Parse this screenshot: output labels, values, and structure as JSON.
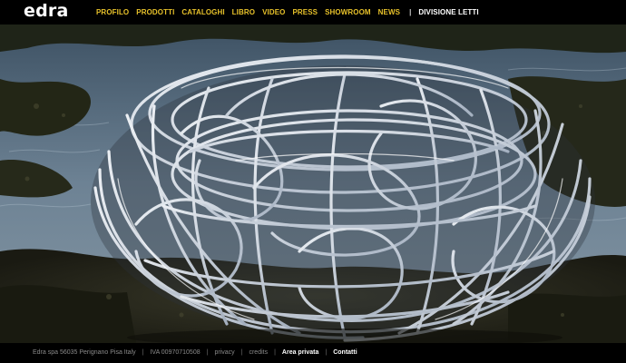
{
  "brand": {
    "logo": "edra"
  },
  "nav": {
    "items": [
      {
        "label": "PROFILO"
      },
      {
        "label": "PRODOTTI"
      },
      {
        "label": "CATALOGHI"
      },
      {
        "label": "LIBRO"
      },
      {
        "label": "VIDEO"
      },
      {
        "label": "PRESS"
      },
      {
        "label": "SHOWROOM"
      },
      {
        "label": "NEWS"
      }
    ],
    "separator": "|",
    "division": "DIVISIONE LETTI"
  },
  "hero": {
    "icon": "armchair-photo"
  },
  "footer": {
    "company": "Edra spa 56035 Perignano Pisa Italy",
    "vat": "IVA 00970710508",
    "privacy": "privacy",
    "credits": "credits",
    "private_area": "Area privata",
    "contacts": "Contatti",
    "separator": "|"
  },
  "colors": {
    "nav_accent": "#e7c12a",
    "background": "#000000"
  }
}
